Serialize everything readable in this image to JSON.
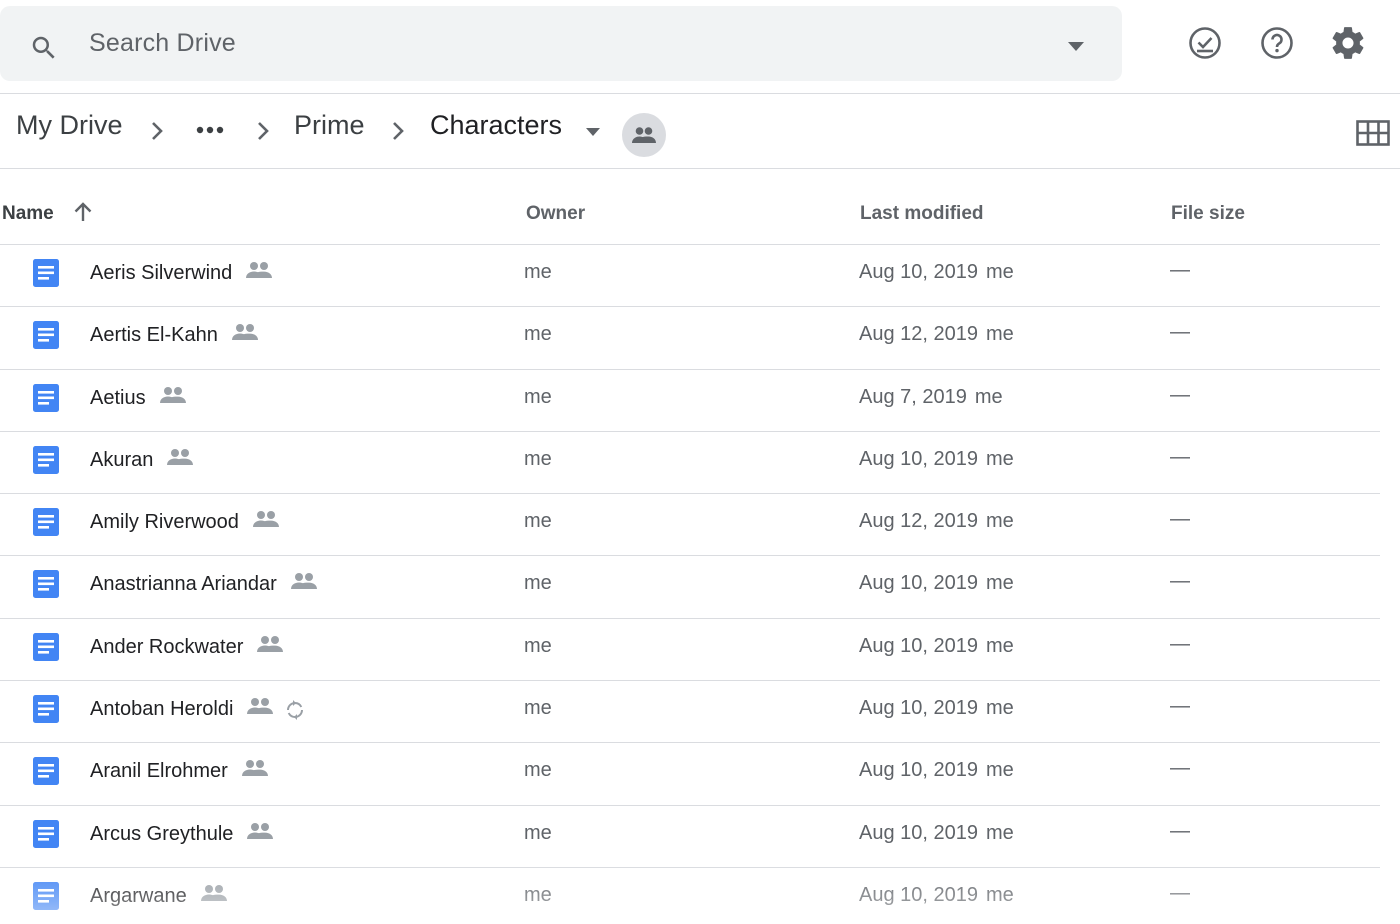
{
  "search": {
    "placeholder": "Search Drive",
    "icon": "search-icon",
    "options_icon": "caret-down-icon"
  },
  "header_icons": [
    "offline-ready-icon",
    "help-icon",
    "settings-icon"
  ],
  "breadcrumb": {
    "root": "My Drive",
    "more": "…",
    "items": [
      "Prime",
      "Characters"
    ],
    "shared_icon": "people-icon"
  },
  "view_toggle_icon": "grid-view-icon",
  "columns": {
    "name": "Name",
    "owner": "Owner",
    "last_modified": "Last modified",
    "file_size": "File size"
  },
  "colors": {
    "doc_blue": "#4285f4",
    "icon_grey": "#5f6368",
    "divider": "#dadce0",
    "search_bg": "#f1f3f4"
  },
  "files": [
    {
      "name": "Aeris Silverwind",
      "owner": "me",
      "modified": "Aug 10, 2019",
      "modified_by": "me",
      "size": "—",
      "shared": true,
      "syncing": false
    },
    {
      "name": "Aertis El-Kahn",
      "owner": "me",
      "modified": "Aug 12, 2019",
      "modified_by": "me",
      "size": "—",
      "shared": true,
      "syncing": false
    },
    {
      "name": "Aetius",
      "owner": "me",
      "modified": "Aug 7, 2019",
      "modified_by": "me",
      "size": "—",
      "shared": true,
      "syncing": false
    },
    {
      "name": "Akuran",
      "owner": "me",
      "modified": "Aug 10, 2019",
      "modified_by": "me",
      "size": "—",
      "shared": true,
      "syncing": false
    },
    {
      "name": "Amily Riverwood",
      "owner": "me",
      "modified": "Aug 12, 2019",
      "modified_by": "me",
      "size": "—",
      "shared": true,
      "syncing": false
    },
    {
      "name": "Anastrianna Ariandar",
      "owner": "me",
      "modified": "Aug 10, 2019",
      "modified_by": "me",
      "size": "—",
      "shared": true,
      "syncing": false
    },
    {
      "name": "Ander Rockwater",
      "owner": "me",
      "modified": "Aug 10, 2019",
      "modified_by": "me",
      "size": "—",
      "shared": true,
      "syncing": false
    },
    {
      "name": "Antoban Heroldi",
      "owner": "me",
      "modified": "Aug 10, 2019",
      "modified_by": "me",
      "size": "—",
      "shared": true,
      "syncing": true
    },
    {
      "name": "Aranil Elrohmer",
      "owner": "me",
      "modified": "Aug 10, 2019",
      "modified_by": "me",
      "size": "—",
      "shared": true,
      "syncing": false
    },
    {
      "name": "Arcus Greythule",
      "owner": "me",
      "modified": "Aug 10, 2019",
      "modified_by": "me",
      "size": "—",
      "shared": true,
      "syncing": false
    },
    {
      "name": "Argarwane",
      "owner": "me",
      "modified": "Aug 10, 2019",
      "modified_by": "me",
      "size": "—",
      "shared": true,
      "syncing": false
    }
  ]
}
